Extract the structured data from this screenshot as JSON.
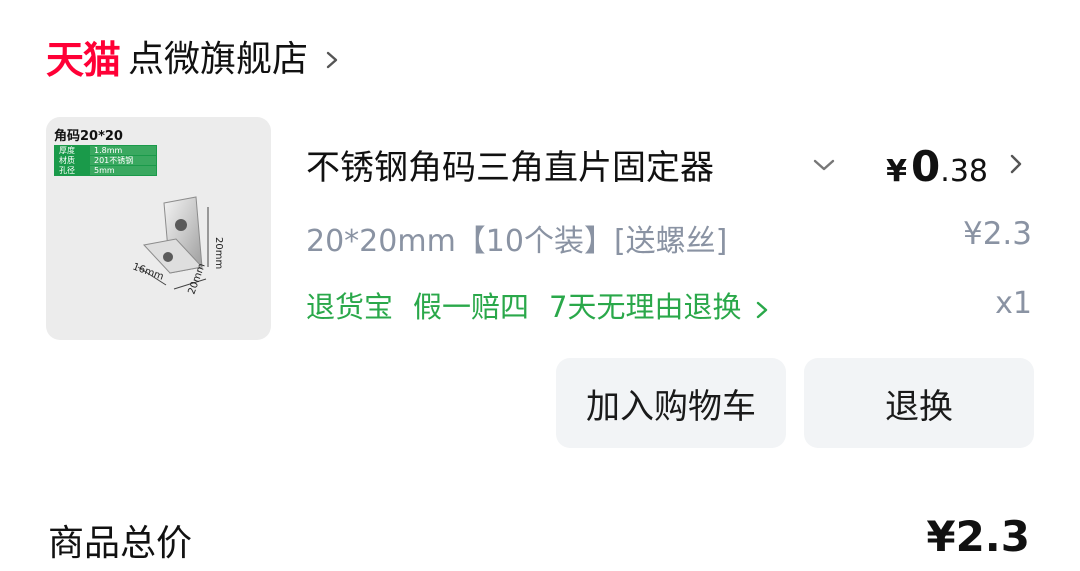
{
  "shop": {
    "platform_logo": "天猫",
    "name": "点微旗舰店",
    "chevron_icon": "chevron-right-icon"
  },
  "product": {
    "thumbnail": {
      "title": "角码20*20",
      "specs": [
        {
          "key": "厚度",
          "value": "1.8mm"
        },
        {
          "key": "材质",
          "value": "201不锈钢"
        },
        {
          "key": "孔径",
          "value": "5mm"
        }
      ],
      "dimension_labels": [
        "20mm",
        "20mm",
        "16mm"
      ]
    },
    "title": "不锈钢角码三角直片固定器",
    "variant": "20*20mm【10个装】[送螺丝]",
    "price": {
      "symbol": "¥",
      "integer": "0",
      "decimal": ".38"
    },
    "original_price": "¥2.3",
    "quantity": "x1",
    "services": [
      "退货宝",
      "假一赔四",
      "7天无理由退换"
    ]
  },
  "actions": {
    "add_to_cart": "加入购物车",
    "return_exchange": "退换"
  },
  "summary": {
    "label": "商品总价",
    "value": "¥2.3"
  },
  "colors": {
    "brand_red": "#ff0036",
    "service_green": "#2aa84a",
    "muted_gray": "#8a93a3",
    "button_bg": "#f2f4f6"
  }
}
